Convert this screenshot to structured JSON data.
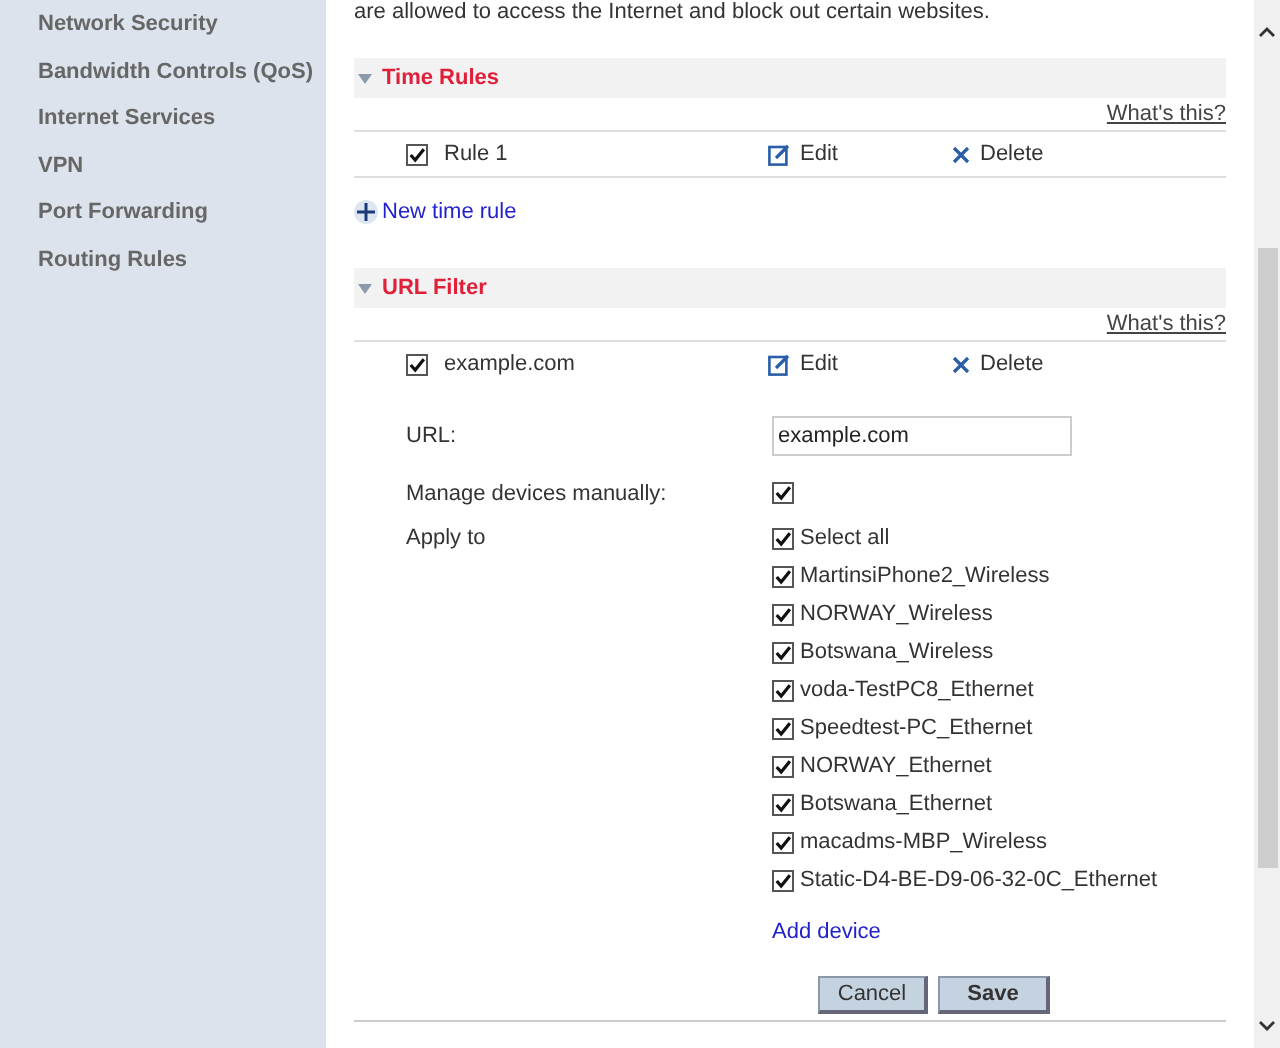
{
  "sidebar": {
    "items": [
      {
        "label": "Network Security"
      },
      {
        "label": "Bandwidth Controls (QoS)"
      },
      {
        "label": "Internet Services"
      },
      {
        "label": "VPN"
      },
      {
        "label": "Port Forwarding"
      },
      {
        "label": "Routing Rules"
      }
    ]
  },
  "intro": "are allowed to access the Internet and block out certain websites.",
  "time_rules": {
    "title": "Time Rules",
    "expanded": true,
    "help": "What's this?",
    "rules": [
      {
        "label": "Rule 1",
        "checked": true,
        "edit": "Edit",
        "delete": "Delete"
      }
    ],
    "add": "New time rule"
  },
  "url_filter": {
    "title": "URL Filter",
    "expanded": true,
    "help": "What's this?",
    "rules": [
      {
        "label": "example.com",
        "checked": true,
        "edit": "Edit",
        "delete": "Delete"
      }
    ],
    "url_label": "URL:",
    "url_value": "example.com",
    "manage_label": "Manage devices manually:",
    "manage_checked": true,
    "apply_label": "Apply to",
    "devices": [
      {
        "label": "Select all",
        "checked": true
      },
      {
        "label": "MartinsiPhone2_Wireless",
        "checked": true
      },
      {
        "label": "NORWAY_Wireless",
        "checked": true
      },
      {
        "label": "Botswana_Wireless",
        "checked": true
      },
      {
        "label": "voda-TestPC8_Ethernet",
        "checked": true
      },
      {
        "label": "Speedtest-PC_Ethernet",
        "checked": true
      },
      {
        "label": "NORWAY_Ethernet",
        "checked": true
      },
      {
        "label": "Botswana_Ethernet",
        "checked": true
      },
      {
        "label": "macadms-MBP_Wireless",
        "checked": true
      },
      {
        "label": "Static-D4-BE-D9-06-32-0C_Ethernet",
        "checked": true
      }
    ],
    "add_device": "Add device",
    "cancel": "Cancel",
    "save": "Save"
  }
}
